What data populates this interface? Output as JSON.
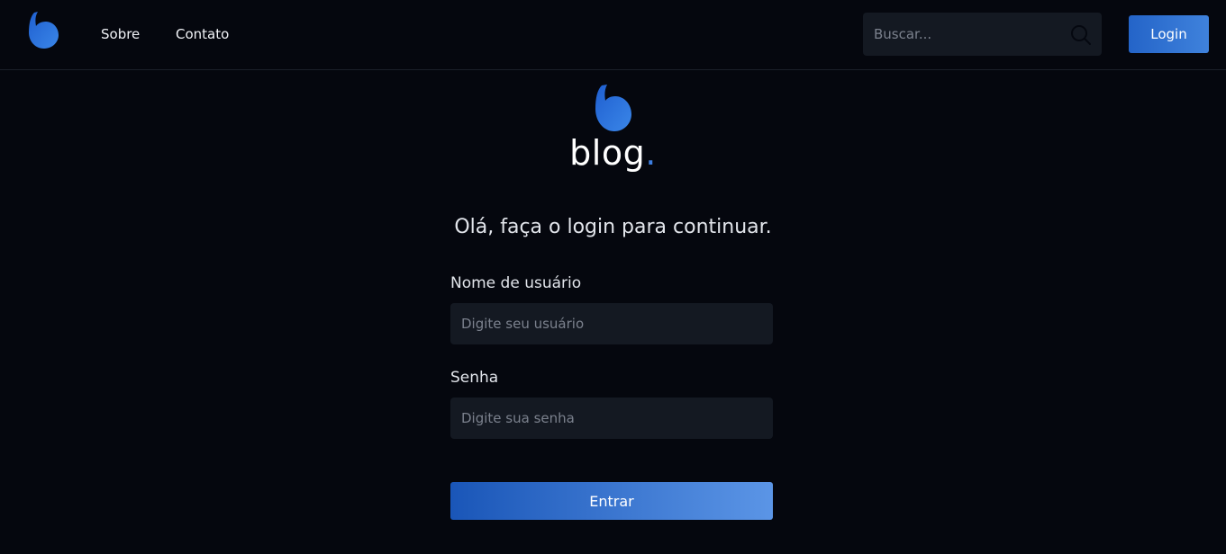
{
  "header": {
    "nav": [
      {
        "label": "Sobre"
      },
      {
        "label": "Contato"
      }
    ],
    "search": {
      "placeholder": "Buscar...",
      "value": "",
      "icon": "search-icon"
    },
    "login_label": "Login"
  },
  "brand": {
    "name": "blog",
    "dot": "."
  },
  "login_form": {
    "heading": "Olá, faça o login para continuar.",
    "username_label": "Nome de usuário",
    "username_placeholder": "Digite seu usuário",
    "username_value": "",
    "password_label": "Senha",
    "password_placeholder": "Digite sua senha",
    "password_value": "",
    "submit_label": "Entrar"
  },
  "colors": {
    "background": "#05070e",
    "accent": "#2f6fd4",
    "input_background": "#141922"
  }
}
